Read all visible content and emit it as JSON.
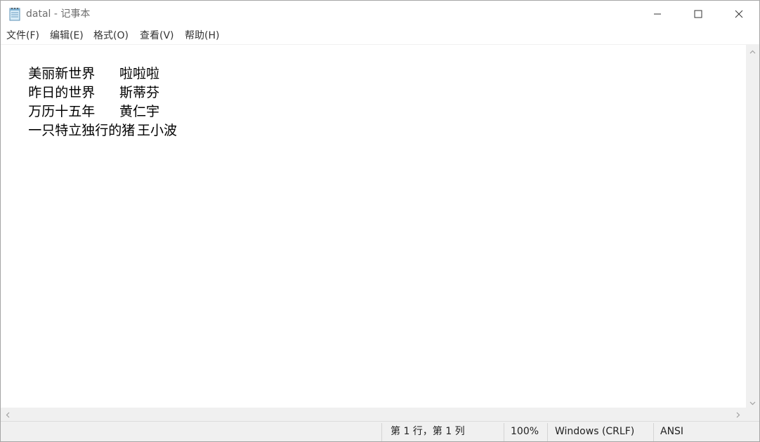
{
  "window": {
    "title": "datal - 记事本",
    "icon": "notepad-icon",
    "controls": {
      "minimize_icon": "minimize-icon",
      "maximize_icon": "maximize-icon",
      "close_icon": "close-icon"
    }
  },
  "menu": {
    "items": [
      {
        "label": "文件(F)"
      },
      {
        "label": "编辑(E)"
      },
      {
        "label": "格式(O)"
      },
      {
        "label": "查看(V)"
      },
      {
        "label": "帮助(H)"
      }
    ]
  },
  "editor": {
    "lines": [
      {
        "title": "美丽新世界",
        "author": "啦啦啦"
      },
      {
        "title": "昨日的世界",
        "author": "斯蒂芬"
      },
      {
        "title": "万历十五年",
        "author": "黄仁宇"
      },
      {
        "title": "一只特立独行的猪",
        "author": "王小波"
      }
    ]
  },
  "statusbar": {
    "position": "第 1 行，第 1 列",
    "zoom": "100%",
    "line_ending": "Windows (CRLF)",
    "encoding": "ANSI"
  },
  "colors": {
    "title_text": "#6e6e6e",
    "statusbar_bg": "#f0f0f0",
    "scrollbar_bg": "#f0f0f0"
  }
}
